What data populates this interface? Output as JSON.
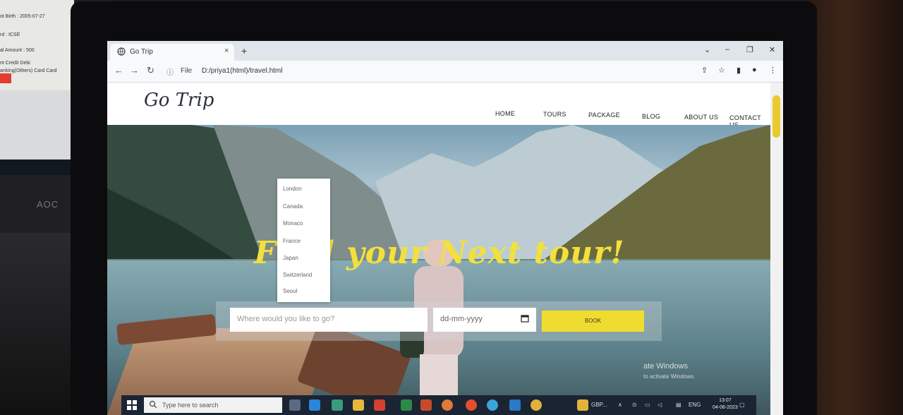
{
  "second_monitor": {
    "lines": [
      "ot Birth : 2005-07-27",
      "rd : ICSE",
      "al Amount : 500",
      "nt   Credit  Debi",
      "anking(Others)  Card   Card"
    ],
    "brand": "AOC"
  },
  "browser": {
    "tab_title": "Go Trip",
    "tab_close": "×",
    "new_tab": "+",
    "address_prefix": "File",
    "address_path": "D:/priya1(html)/travel.html",
    "window_controls": [
      "⌄",
      "–",
      "❐",
      "✕"
    ]
  },
  "site": {
    "logo": "Go Trip",
    "nav": [
      "HOME",
      "TOURS",
      "PACKAGE",
      "BLOG",
      "ABOUT US",
      "CONTACT US"
    ],
    "headline": "Find your Next tour!",
    "destination_placeholder": "Where would you like to go?",
    "date_placeholder": "dd-mm-yyyy",
    "book_label": "BOOK",
    "destinations": [
      "London",
      "Canada",
      "Monaco",
      "France",
      "Japan",
      "Switzerland",
      "Seoul"
    ],
    "watermark_title": "ate Windows",
    "watermark_sub": "to activate Windows."
  },
  "taskbar": {
    "search_placeholder": "Type here to search",
    "weather": "GBP...",
    "language": "ENG",
    "time": "13:07",
    "date": "04-06-2023"
  },
  "colors": {
    "accent_yellow": "#f0dc2e",
    "taskbar": "#1b2433"
  }
}
